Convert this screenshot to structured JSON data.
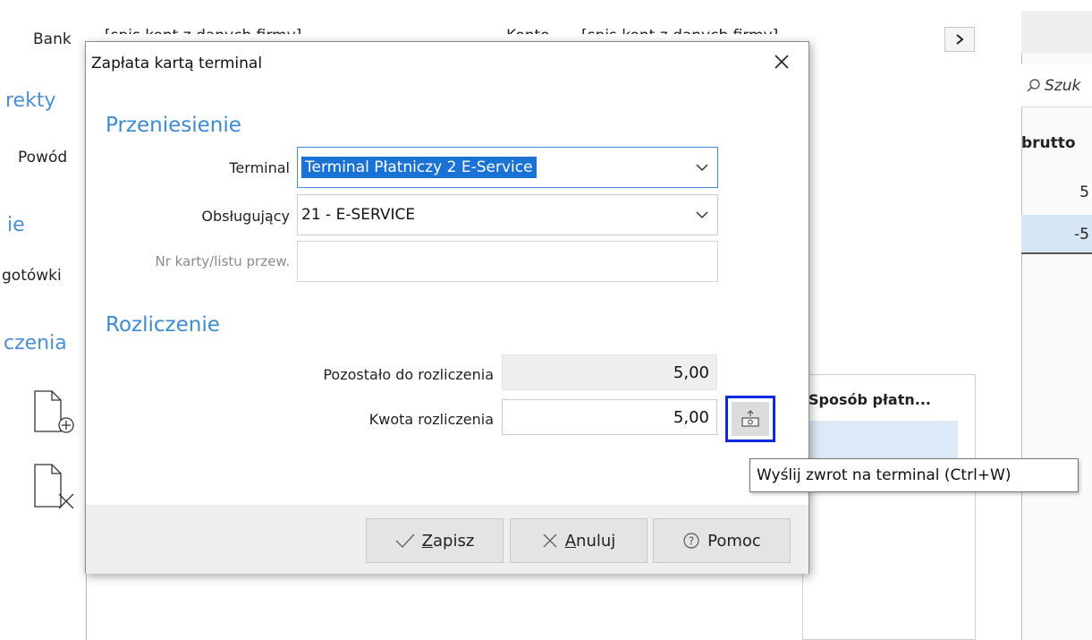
{
  "background": {
    "bank_label": "Bank",
    "bank_value": "[spis kont z danych firmy]",
    "konto_label": "Konto",
    "konto_value": "[spis kont z danych firmy]",
    "korekty_fragment": "rekty",
    "powod_label": "Powód",
    "ie_fragment": "ie",
    "gotowki_fragment": "gotówki",
    "rozliczenia_fragment": "czenia",
    "search_placeholder": "Szuk",
    "brutto_header": "brutto",
    "row1_value": "5",
    "row2_value": "-5",
    "sposob_header": "Sposób płatn..."
  },
  "dialog": {
    "title": "Zapłata kartą terminal",
    "section_transfer": "Przeniesienie",
    "terminal_label": "Terminal",
    "terminal_value": "Terminal Płatniczy 2 E-Service",
    "operator_label": "Obsługujący",
    "operator_value": "21 - E-SERVICE",
    "card_label": "Nr karty/listu przew.",
    "card_value": "",
    "section_settlement": "Rozliczenie",
    "remaining_label": "Pozostało do rozliczenia",
    "remaining_value": "5,00",
    "amount_label": "Kwota rozliczenia",
    "amount_value": "5,00",
    "buttons": {
      "save_prefix": "",
      "save_underlined": "Z",
      "save_rest": "apisz",
      "cancel_underlined": "A",
      "cancel_rest": "nuluj",
      "help": "Pomoc"
    }
  },
  "tooltip": "Wyślij zwrot na terminal (Ctrl+W)",
  "colors": {
    "accent": "#3c8ad6",
    "selection": "#1a73d4",
    "focus_highlight": "#0a28e6"
  },
  "icons": [
    "chevron-right-icon",
    "search-icon",
    "add-document-icon",
    "remove-document-icon",
    "close-icon",
    "dropdown-arrow-icon",
    "send-to-terminal-icon",
    "check-icon",
    "x-icon",
    "help-icon"
  ]
}
